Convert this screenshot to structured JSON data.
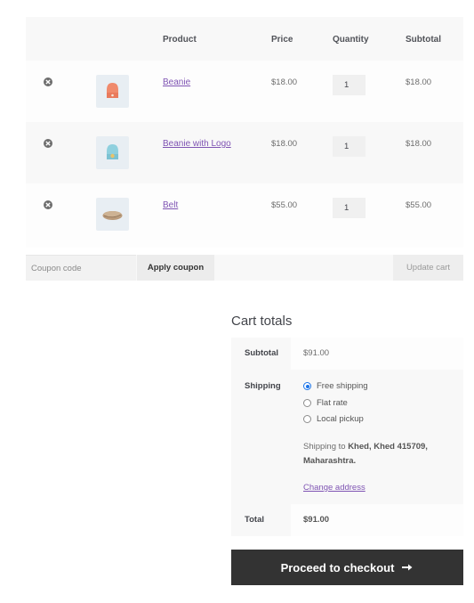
{
  "cart": {
    "columns": [
      "",
      "",
      "Product",
      "Price",
      "Quantity",
      "Subtotal"
    ],
    "items": [
      {
        "name": "Beanie",
        "price": "$18.00",
        "quantity": "1",
        "subtotal": "$18.00",
        "thumb_color": "#f08a6c"
      },
      {
        "name": "Beanie with Logo",
        "price": "$18.00",
        "quantity": "1",
        "subtotal": "$18.00",
        "thumb_color": "#8fd0de"
      },
      {
        "name": "Belt",
        "price": "$55.00",
        "quantity": "1",
        "subtotal": "$55.00",
        "thumb_color": "#b99a7a"
      }
    ],
    "remove_icon": "remove-circle-x-icon"
  },
  "actions": {
    "coupon_placeholder": "Coupon code",
    "apply_label": "Apply coupon",
    "update_label": "Update cart"
  },
  "totals": {
    "title": "Cart totals",
    "subtotal_label": "Subtotal",
    "subtotal_value": "$91.00",
    "shipping_label": "Shipping",
    "shipping_options": [
      {
        "label": "Free shipping",
        "checked": true
      },
      {
        "label": "Flat rate",
        "checked": false
      },
      {
        "label": "Local pickup",
        "checked": false
      }
    ],
    "shipping_to_prefix": "Shipping to",
    "shipping_to_address": "Khed, Khed 415709, Maharashtra",
    "change_address": "Change address",
    "total_label": "Total",
    "total_value": "$91.00"
  },
  "checkout": {
    "label": "Proceed to checkout",
    "icon": "arrow-right-icon"
  },
  "colors": {
    "link": "#7f54b3",
    "checkout_bg": "#333333",
    "radio_selected": "#1a73e8"
  }
}
